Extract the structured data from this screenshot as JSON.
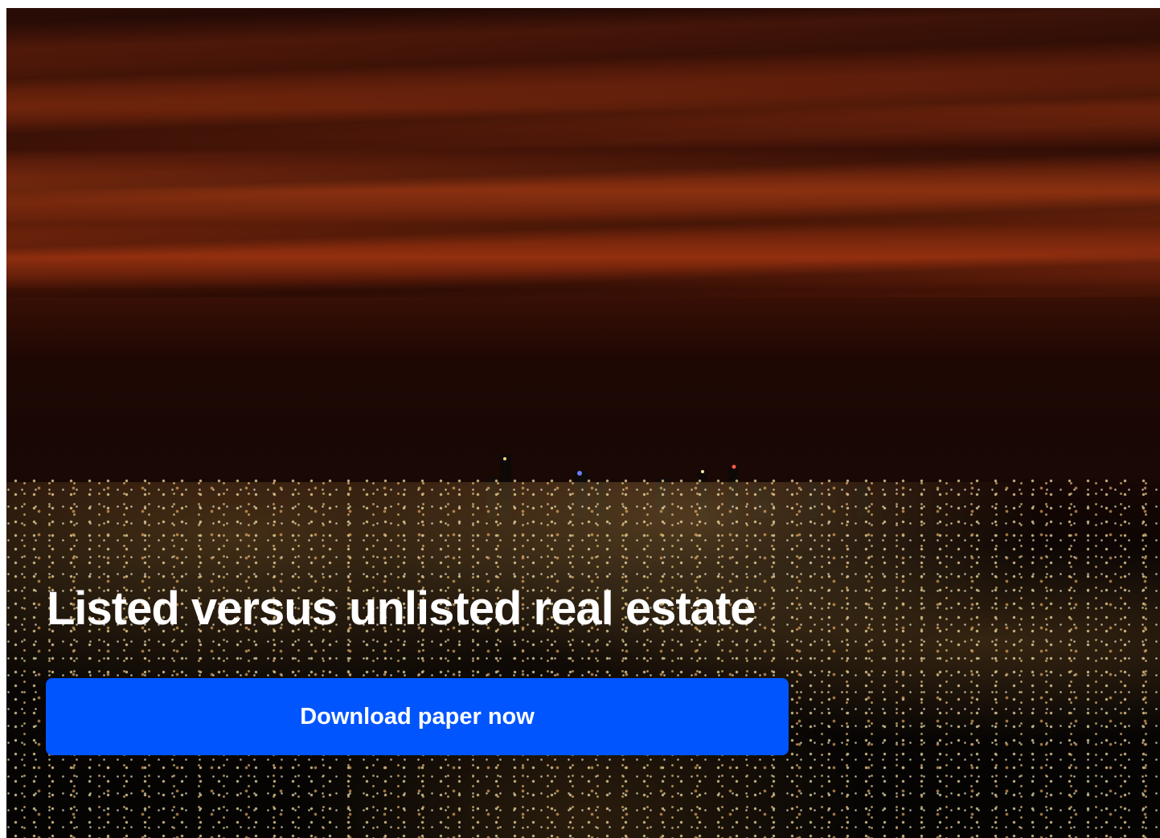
{
  "hero": {
    "title": "Listed versus unlisted real estate",
    "cta_label": "Download paper now",
    "background_image": "city-night-skyline-photo"
  },
  "colors": {
    "cta_background": "#0055ff",
    "cta_text": "#ffffff",
    "title_text": "#ffffff"
  }
}
